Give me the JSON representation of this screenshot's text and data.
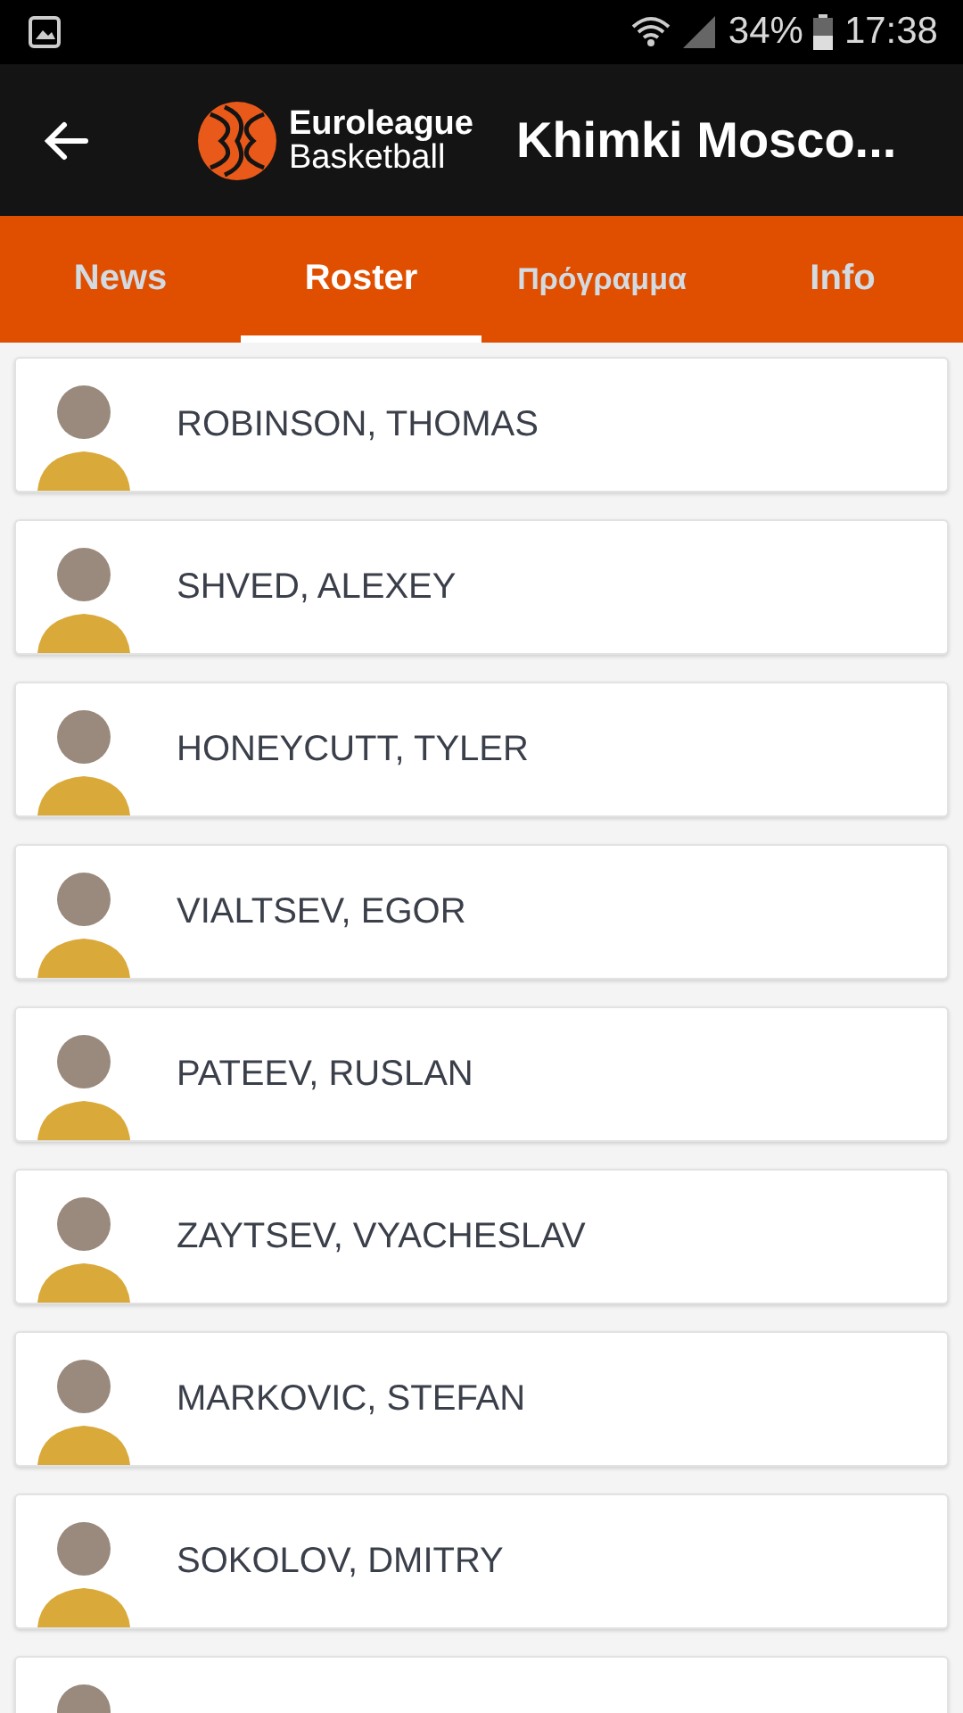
{
  "status_bar": {
    "battery": "34%",
    "time": "17:38"
  },
  "header": {
    "logo_top": "Euroleague",
    "logo_bottom": "Basketball",
    "title": "Khimki Mosco..."
  },
  "tabs": [
    {
      "label": "News",
      "selected": false
    },
    {
      "label": "Roster",
      "selected": true
    },
    {
      "label": "Πρόγραμμα",
      "selected": false
    },
    {
      "label": "Info",
      "selected": false
    }
  ],
  "players": [
    {
      "name": "ROBINSON, THOMAS"
    },
    {
      "name": "SHVED, ALEXEY"
    },
    {
      "name": "HONEYCUTT, TYLER"
    },
    {
      "name": "VIALTSEV, EGOR"
    },
    {
      "name": "PATEEV, RUSLAN"
    },
    {
      "name": "ZAYTSEV, VYACHESLAV"
    },
    {
      "name": "MARKOVIC, STEFAN"
    },
    {
      "name": "SOKOLOV, DMITRY"
    }
  ]
}
